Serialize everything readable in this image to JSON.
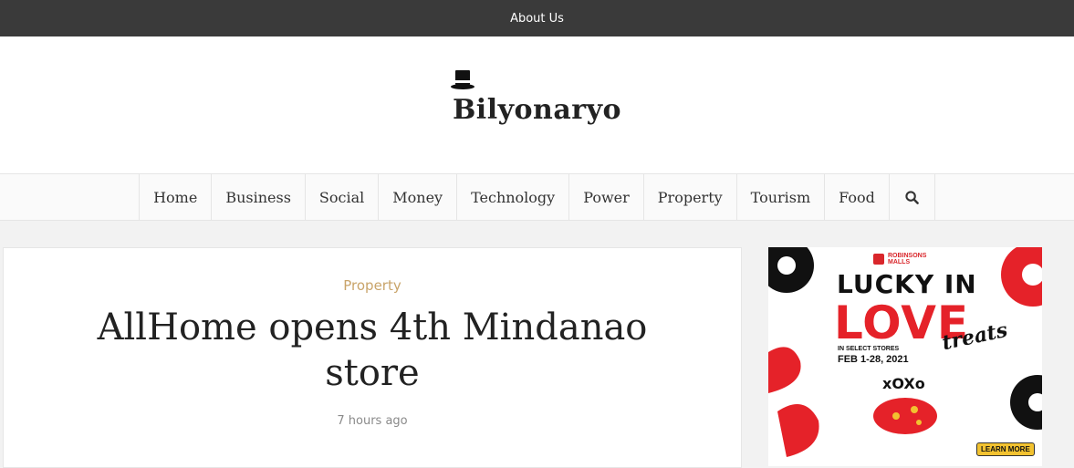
{
  "topbar": {
    "about_label": "About Us"
  },
  "brand": {
    "name": "Bilyonaryo"
  },
  "nav": {
    "items": [
      "Home",
      "Business",
      "Social",
      "Money",
      "Technology",
      "Power",
      "Property",
      "Tourism",
      "Food"
    ]
  },
  "article": {
    "category": "Property",
    "title": "AllHome opens 4th Mindanao store",
    "time": "7 hours ago"
  },
  "ad": {
    "brand": "ROBINSONS MALLS",
    "line1": "LUCKY IN",
    "line2": "LOVE",
    "line3": "treats",
    "line4": "IN SELECT STORES",
    "line5": "FEB 1-28, 2021",
    "xoxo": "xOXo",
    "cta": "LEARN MORE",
    "colors": {
      "red": "#e52229",
      "black": "#111111",
      "gold": "#f2c230"
    }
  },
  "colors": {
    "topbar": "#3a3a3a",
    "category": "#c9a46a",
    "title": "#222222"
  }
}
